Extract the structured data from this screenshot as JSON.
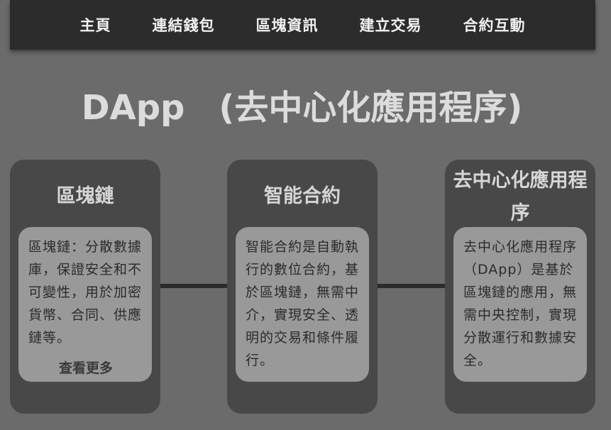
{
  "nav": {
    "items": [
      "主頁",
      "連結錢包",
      "區塊資訊",
      "建立交易",
      "合約互動"
    ]
  },
  "page": {
    "title": "DApp　(去中心化應用程序)"
  },
  "cards": [
    {
      "title": "區塊鏈",
      "text": "區塊鏈：分散數據庫，保證安全和不可變性，用於加密貨幣、合同、供應鏈等。",
      "more": "查看更多"
    },
    {
      "title": "智能合約",
      "text": "智能合約是自動執行的數位合約，基於區塊鏈，無需中介，實現安全、透明的交易和條件履行。"
    },
    {
      "title": "去中心化應用程序",
      "text": "去中心化應用程序（DApp）是基於區塊鏈的應用，無需中央控制，實現分散運行和數據安全。"
    }
  ],
  "colors": {
    "background": "#6b6b6b",
    "nav": "#2c2c2c",
    "card": "#484848",
    "card_body": "#999999"
  }
}
